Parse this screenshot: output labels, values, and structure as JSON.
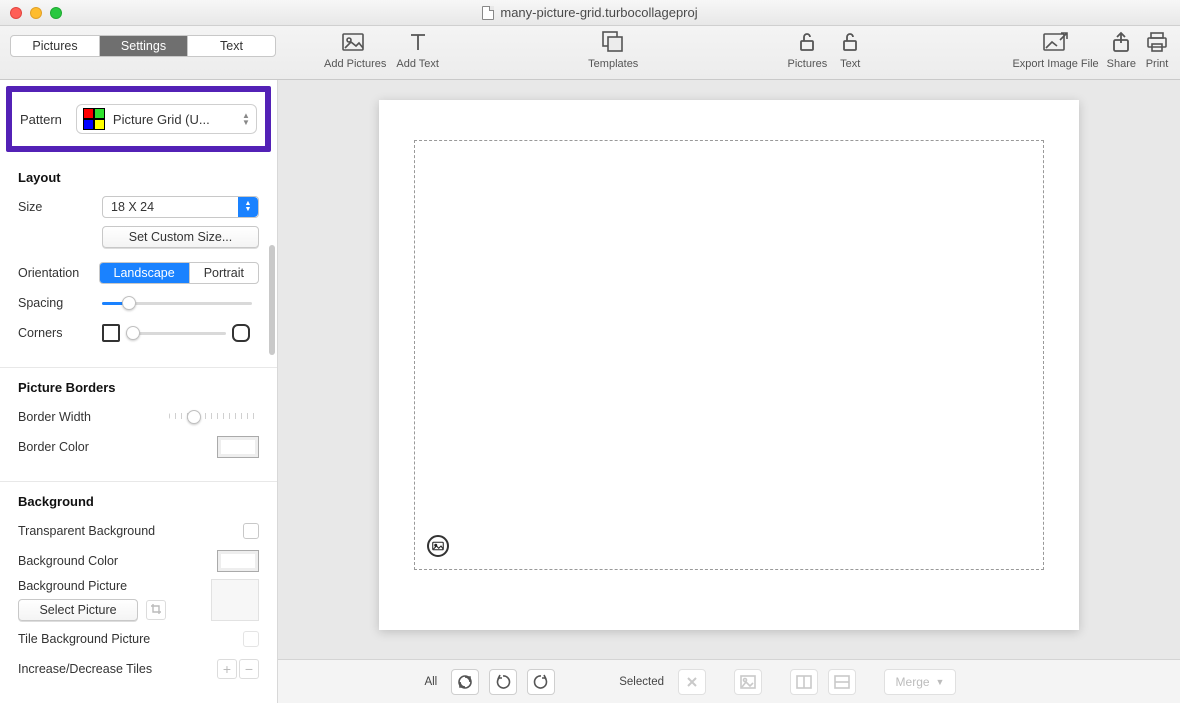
{
  "window": {
    "title": "many-picture-grid.turbocollageproj"
  },
  "tabs": {
    "pictures": "Pictures",
    "settings": "Settings",
    "text": "Text",
    "active": "settings"
  },
  "toolbar": {
    "add_pictures": "Add Pictures",
    "add_text": "Add Text",
    "templates": "Templates",
    "lock_pictures": "Pictures",
    "lock_text": "Text",
    "export": "Export Image File",
    "share": "Share",
    "print": "Print"
  },
  "pattern": {
    "label": "Pattern",
    "value": "Picture Grid (U..."
  },
  "layout": {
    "heading": "Layout",
    "size_label": "Size",
    "size_value": "18 X 24",
    "custom_size_btn": "Set Custom Size...",
    "orientation_label": "Orientation",
    "orientation_landscape": "Landscape",
    "orientation_portrait": "Portrait",
    "spacing_label": "Spacing",
    "corners_label": "Corners"
  },
  "picture_borders": {
    "heading": "Picture Borders",
    "width_label": "Border Width",
    "color_label": "Border Color"
  },
  "background": {
    "heading": "Background",
    "transparent_label": "Transparent Background",
    "color_label": "Background Color",
    "picture_label": "Background Picture",
    "select_btn": "Select Picture",
    "tile_label": "Tile Background Picture",
    "tiles_label": "Increase/Decrease Tiles"
  },
  "bottombar": {
    "all_label": "All",
    "selected_label": "Selected",
    "merge_label": "Merge"
  }
}
